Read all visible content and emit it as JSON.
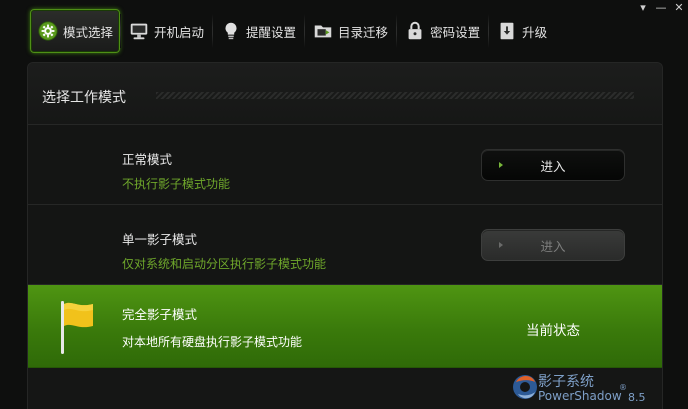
{
  "window": {
    "controls": [
      "▾",
      "—",
      "✕"
    ]
  },
  "nav": {
    "items": [
      {
        "label": "模式选择",
        "icon": "gear-icon",
        "active": true
      },
      {
        "label": "开机启动",
        "icon": "monitor-icon",
        "active": false
      },
      {
        "label": "提醒设置",
        "icon": "lightbulb-icon",
        "active": false
      },
      {
        "label": "目录迁移",
        "icon": "folder-move-icon",
        "active": false
      },
      {
        "label": "密码设置",
        "icon": "lock-icon",
        "active": false
      },
      {
        "label": "升级",
        "icon": "download-icon",
        "active": false
      }
    ]
  },
  "panel": {
    "title": "选择工作模式",
    "modes": [
      {
        "title": "正常模式",
        "desc": "不执行影子模式功能",
        "button": "进入",
        "enabled": true
      },
      {
        "title": "单一影子模式",
        "desc": "仅对系统和启动分区执行影子模式功能",
        "button": "进入",
        "enabled": false
      },
      {
        "title": "完全影子模式",
        "desc": "对本地所有硬盘执行影子模式功能",
        "status": "当前状态",
        "icon": "flag-icon"
      }
    ]
  },
  "branding": {
    "name_cn": "影子系统",
    "name_en": "PowerShadow",
    "reg": "®",
    "version": "8.5"
  },
  "colors": {
    "accent_green": "#4f9512",
    "desc_green": "#6fa82b",
    "background": "#0e0f0e"
  }
}
